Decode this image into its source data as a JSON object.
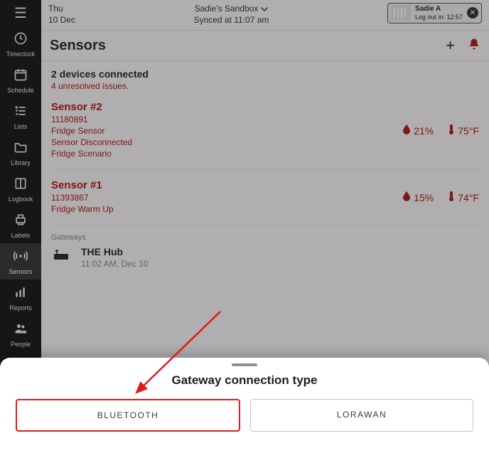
{
  "nav": [
    {
      "key": "timeclock",
      "label": "Timeclock",
      "icon": "clock"
    },
    {
      "key": "schedule",
      "label": "Schedule",
      "icon": "calendar"
    },
    {
      "key": "lists",
      "label": "Lists",
      "icon": "list"
    },
    {
      "key": "library",
      "label": "Library",
      "icon": "folder"
    },
    {
      "key": "logbook",
      "label": "Logbook",
      "icon": "book"
    },
    {
      "key": "labels",
      "label": "Labels",
      "icon": "printer"
    },
    {
      "key": "sensors",
      "label": "Sensors",
      "icon": "signal",
      "active": true
    },
    {
      "key": "reports",
      "label": "Reports",
      "icon": "chart"
    },
    {
      "key": "people",
      "label": "People",
      "icon": "people"
    }
  ],
  "header": {
    "day": "Thu",
    "date": "10 Dec",
    "sandbox": "Sadie's Sandbox",
    "synced": "Synced at 11:07 am",
    "user_name": "Sadie A",
    "logout": "Log out in: 12:57"
  },
  "page": {
    "title": "Sensors"
  },
  "summary": {
    "connected": "2 devices connected",
    "issues": "4 unresolved issues."
  },
  "sensors": [
    {
      "name": "Sensor #2",
      "id": "11180891",
      "lines": [
        "Fridge Sensor",
        "Sensor Disconnected",
        "Fridge Scenario"
      ],
      "humidity": "21%",
      "temp": "75°F"
    },
    {
      "name": "Sensor #1",
      "id": "11393867",
      "lines": [
        "Fridge Warm Up"
      ],
      "humidity": "15%",
      "temp": "74°F"
    }
  ],
  "gateways_label": "Gateways",
  "gateway": {
    "name": "THE Hub",
    "time": "11:02 AM, Dec 10"
  },
  "sheet": {
    "title": "Gateway connection type",
    "opt_bluetooth": "BLUETOOTH",
    "opt_lorawan": "LORAWAN"
  }
}
